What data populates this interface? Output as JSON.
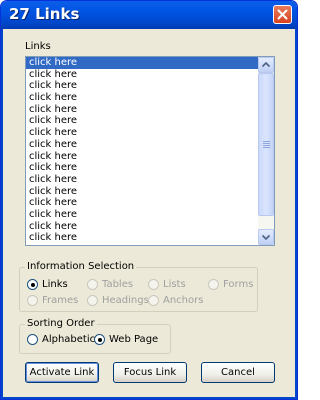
{
  "window": {
    "title": "27 Links"
  },
  "links_label": "Links",
  "links": [
    "click here",
    "click here",
    "click here",
    "click here",
    "click here",
    "click here",
    "click here",
    "click here",
    "click here",
    "click here",
    "click here",
    "click here",
    "click here",
    "click here",
    "click here",
    "click here"
  ],
  "selected_index": 0,
  "info_selection": {
    "legend": "Information Selection",
    "options": [
      {
        "label": "Links",
        "checked": true,
        "enabled": true
      },
      {
        "label": "Tables",
        "checked": false,
        "enabled": false
      },
      {
        "label": "Lists",
        "checked": false,
        "enabled": false
      },
      {
        "label": "Forms",
        "checked": false,
        "enabled": false
      },
      {
        "label": "Frames",
        "checked": false,
        "enabled": false
      },
      {
        "label": "Headings",
        "checked": false,
        "enabled": false
      },
      {
        "label": "Anchors",
        "checked": false,
        "enabled": false
      }
    ]
  },
  "sorting_order": {
    "legend": "Sorting Order",
    "options": [
      {
        "label": "Alphabetic",
        "checked": false
      },
      {
        "label": "Web Page",
        "checked": true
      }
    ]
  },
  "buttons": {
    "activate": "Activate Link",
    "focus": "Focus Link",
    "cancel": "Cancel"
  },
  "colors": {
    "title_bar": "#0054e3",
    "selection": "#316ac5",
    "dialog_bg": "#ece9d8",
    "close_button": "#d8421f"
  }
}
